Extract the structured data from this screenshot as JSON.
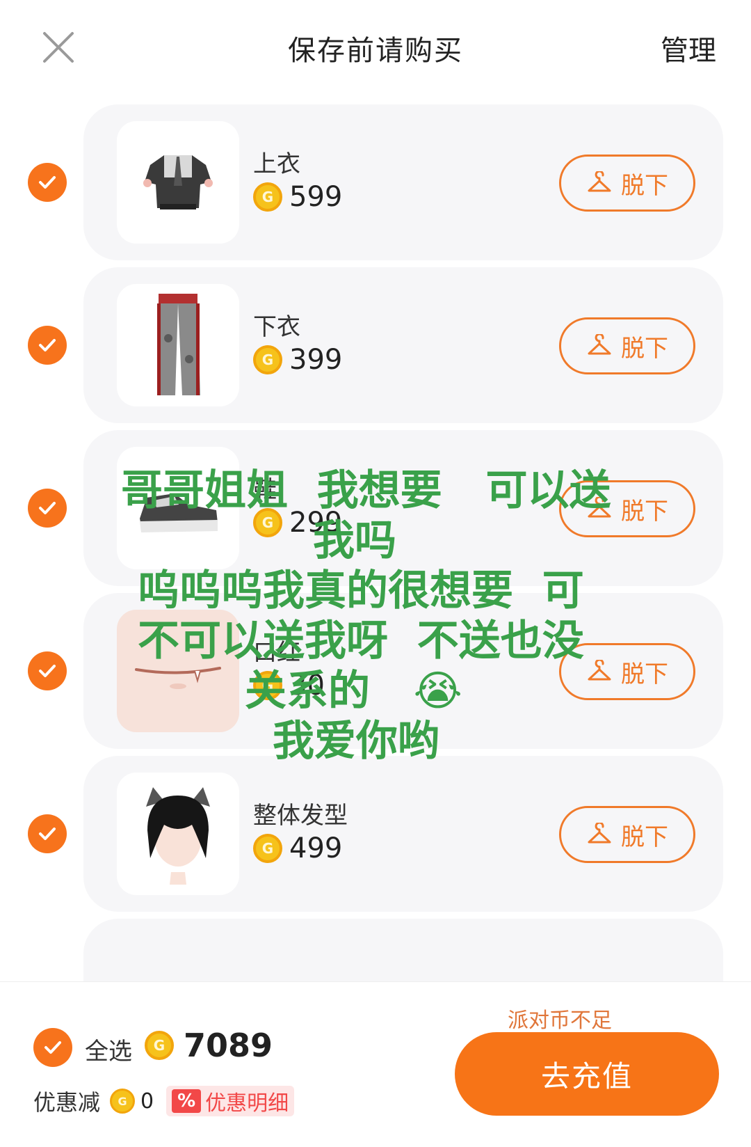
{
  "header": {
    "title": "保存前请购买",
    "manage_label": "管理"
  },
  "items": [
    {
      "name": "上衣",
      "price": "599",
      "action": "脱下",
      "icon": "shirt-thumbnail"
    },
    {
      "name": "下衣",
      "price": "399",
      "action": "脱下",
      "icon": "pants-thumbnail"
    },
    {
      "name": "鞋",
      "price": "299",
      "action": "脱下",
      "icon": "shoes-thumbnail"
    },
    {
      "name": "口红",
      "price": "30",
      "action": "脱下",
      "icon": "lipstick-thumbnail"
    },
    {
      "name": "整体发型",
      "price": "499",
      "action": "脱下",
      "icon": "hairstyle-thumbnail"
    }
  ],
  "overlay_text": {
    "line1": "哥哥姐姐  我想要   可以送",
    "line2": "我吗",
    "line3": "呜呜呜我真的很想要  可",
    "line4": "不可以送我呀  不送也没",
    "line5": "关系的   😭",
    "line6": "我爱你哟"
  },
  "footer": {
    "select_all_label": "全选",
    "total": "7089",
    "discount_label": "优惠减",
    "discount_value": "0",
    "discount_badge": "%",
    "discount_detail": "优惠明细",
    "insufficient_label": "派对币不足",
    "recharge_label": "去充值"
  },
  "colors": {
    "accent": "#f77417",
    "coin": "#f6c21b",
    "overlay_text": "#3aa14a",
    "discount": "#f24848"
  }
}
